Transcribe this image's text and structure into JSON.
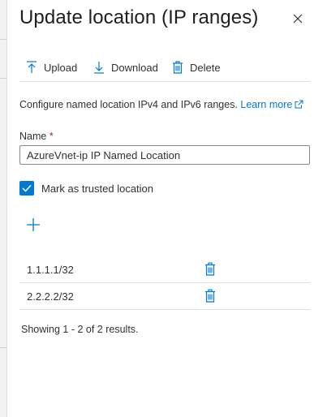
{
  "panel": {
    "title": "Update location (IP ranges)",
    "close_icon": "close-icon"
  },
  "toolbar": {
    "upload_label": "Upload",
    "download_label": "Download",
    "delete_label": "Delete",
    "upload_icon": "upload-icon",
    "download_icon": "download-icon",
    "delete_icon": "trash-icon"
  },
  "description": {
    "text": "Configure named location IPv4 and IPv6 ranges.",
    "link_text": "Learn more",
    "link_icon": "external-link-icon"
  },
  "name_field": {
    "label": "Name",
    "required_marker": "*",
    "value": "AzureVnet-ip IP Named Location"
  },
  "trusted": {
    "label": "Mark as trusted location",
    "checked": true
  },
  "add_icon": "plus-icon",
  "ip_ranges": [
    {
      "value": "1.1.1.1/32"
    },
    {
      "value": "2.2.2.2/32"
    }
  ],
  "results_text": "Showing 1 - 2 of 2 results.",
  "colors": {
    "accent": "#0078d4",
    "text": "#323130",
    "divider": "#e1dfdd",
    "required": "#a4262c"
  }
}
